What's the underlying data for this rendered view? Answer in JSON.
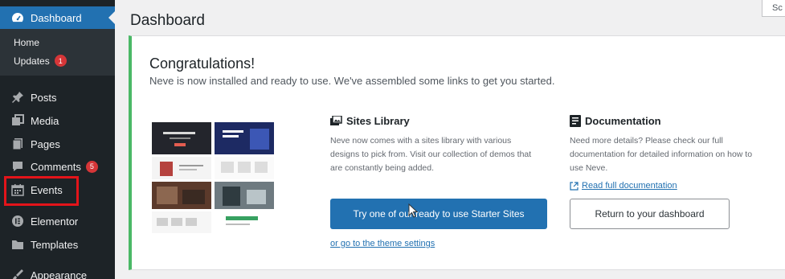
{
  "sidebar": {
    "dashboard_label": "Dashboard",
    "submenu": [
      {
        "label": "Home"
      },
      {
        "label": "Updates",
        "badge": "1"
      }
    ],
    "items": [
      {
        "label": "Posts",
        "icon": "pin-icon"
      },
      {
        "label": "Media",
        "icon": "media-icon"
      },
      {
        "label": "Pages",
        "icon": "pages-icon"
      },
      {
        "label": "Comments",
        "icon": "comment-icon",
        "badge": "5"
      },
      {
        "label": "Events",
        "icon": "calendar-icon"
      },
      {
        "label": "Elementor",
        "icon": "elementor-icon"
      },
      {
        "label": "Templates",
        "icon": "folder-icon"
      },
      {
        "label": "Appearance",
        "icon": "brush-icon"
      }
    ]
  },
  "header": {
    "title": "Dashboard",
    "screen_options_label": "Sc"
  },
  "notice": {
    "title": "Congratulations!",
    "description": "Neve is now installed and ready to use. We've assembled some links to get you started.",
    "sites_library": {
      "heading": "Sites Library",
      "text_lines": [
        "Neve now comes with a sites library with various",
        "designs to pick from. Visit our collection of demos that",
        "are constantly being added."
      ],
      "button_label": "Try one of our ready to use Starter Sites",
      "link_label": "or go to the theme settings"
    },
    "documentation": {
      "heading": "Documentation",
      "text_lines": [
        "Need more details? Please check our full",
        "documentation for detailed information on how to",
        "use Neve."
      ],
      "link_label": "Read full documentation",
      "button_label": "Return to your dashboard"
    }
  },
  "colors": {
    "sidebar_bg": "#1d2327",
    "accent": "#2271b1",
    "success_border": "#4ab866",
    "badge": "#d63638",
    "highlight_box": "#e3141a"
  }
}
